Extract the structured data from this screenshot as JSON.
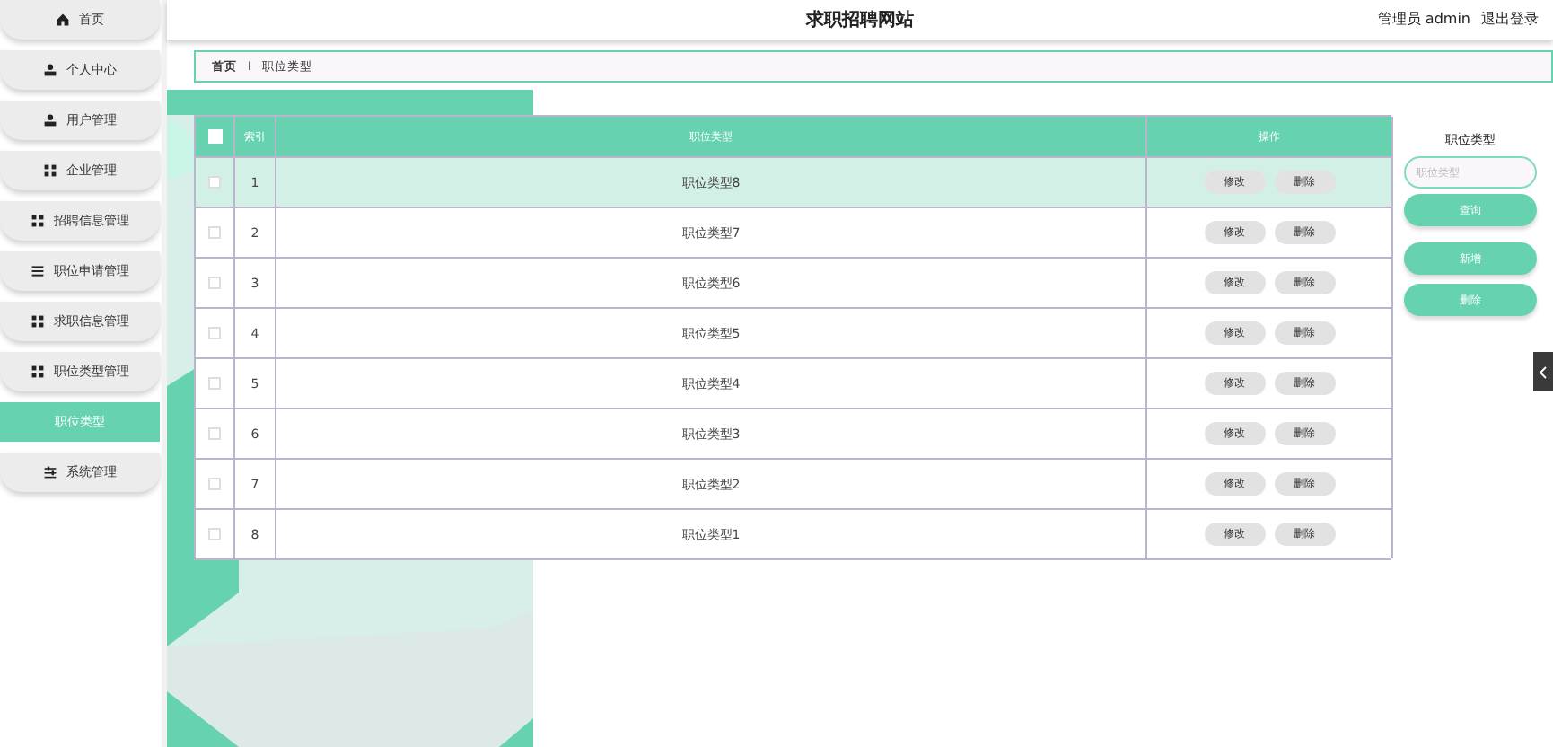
{
  "sidebar": {
    "items": [
      {
        "label": "首页",
        "selected": false
      },
      {
        "label": "个人中心",
        "selected": false
      },
      {
        "label": "用户管理",
        "selected": false
      },
      {
        "label": "企业管理",
        "selected": false
      },
      {
        "label": "招聘信息管理",
        "selected": false
      },
      {
        "label": "职位申请管理",
        "selected": false
      },
      {
        "label": "求职信息管理",
        "selected": false
      },
      {
        "label": "职位类型管理",
        "selected": false
      },
      {
        "label": "职位类型",
        "selected": true
      },
      {
        "label": "系统管理",
        "selected": false
      }
    ]
  },
  "header": {
    "title": "求职招聘网站",
    "user": "管理员 admin",
    "logout": "退出登录"
  },
  "breadcrumb": {
    "home": "首页",
    "separator": "I",
    "current": "职位类型"
  },
  "table": {
    "select_all_checked": false,
    "columns": [
      "索引",
      "职位类型",
      "操作"
    ],
    "rows": [
      {
        "index": "1",
        "type": "职位类型8",
        "selected": true,
        "checked": false,
        "edit": "修改",
        "delete": "删除"
      },
      {
        "index": "2",
        "type": "职位类型7",
        "selected": false,
        "checked": false,
        "edit": "修改",
        "delete": "删除"
      },
      {
        "index": "3",
        "type": "职位类型6",
        "selected": false,
        "checked": false,
        "edit": "修改",
        "delete": "删除"
      },
      {
        "index": "4",
        "type": "职位类型5",
        "selected": false,
        "checked": false,
        "edit": "修改",
        "delete": "删除"
      },
      {
        "index": "5",
        "type": "职位类型4",
        "selected": false,
        "checked": false,
        "edit": "修改",
        "delete": "删除"
      },
      {
        "index": "6",
        "type": "职位类型3",
        "selected": false,
        "checked": false,
        "edit": "修改",
        "delete": "删除"
      },
      {
        "index": "7",
        "type": "职位类型2",
        "selected": false,
        "checked": false,
        "edit": "修改",
        "delete": "删除"
      },
      {
        "index": "8",
        "type": "职位类型1",
        "selected": false,
        "checked": false,
        "edit": "修改",
        "delete": "删除"
      }
    ]
  },
  "search": {
    "label": "职位类型",
    "placeholder": "职位类型",
    "search_button": "查询",
    "add_button": "新增",
    "delete_button": "删除"
  }
}
